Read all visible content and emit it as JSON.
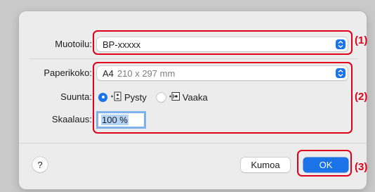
{
  "dialog": {
    "format": {
      "label": "Muotoilu:",
      "value": "BP-xxxxx"
    },
    "paper_size": {
      "label": "Paperikoko:",
      "value": "A4",
      "detail": "210 x 297 mm"
    },
    "orientation": {
      "label": "Suunta:",
      "options": [
        {
          "label": "Pysty",
          "selected": true,
          "icon": "portrait-icon"
        },
        {
          "label": "Vaaka",
          "selected": false,
          "icon": "landscape-icon"
        }
      ]
    },
    "scale": {
      "label": "Skaalaus:",
      "value": "100 %"
    },
    "help_label": "?",
    "cancel_label": "Kumoa",
    "ok_label": "OK"
  },
  "callouts": [
    "(1)",
    "(2)",
    "(3)"
  ],
  "colors": {
    "accent": "#1a73e8",
    "callout": "#e0001b",
    "dialog_bg": "#ececec",
    "desktop_bg": "#c9c9c9"
  }
}
